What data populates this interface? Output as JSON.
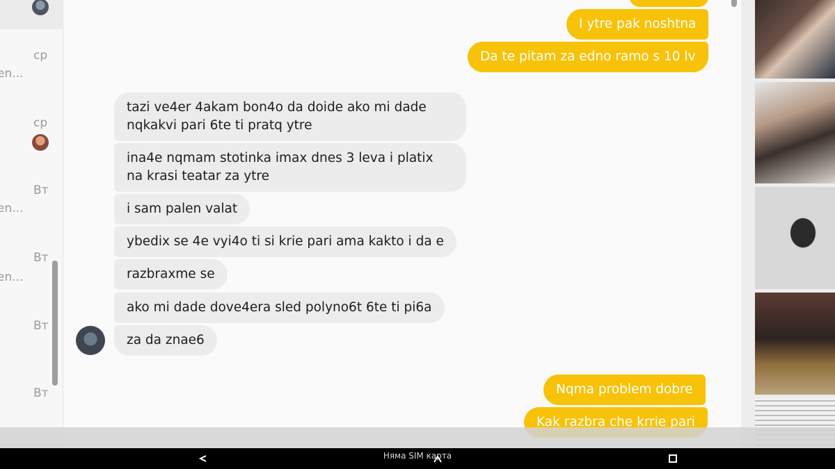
{
  "sidebar": {
    "days": [
      "ср",
      "ср",
      "Вт",
      "Вт",
      "Вт",
      "Вт"
    ],
    "snippets": [
      "en...",
      "en...",
      "en..."
    ]
  },
  "chat": {
    "messages": [
      {
        "side": "out",
        "text": "I ytre pak noshtna"
      },
      {
        "side": "out",
        "text": "Da te pitam za edno ramo s 10 lv"
      },
      {
        "side": "in",
        "text": "tazi ve4er 4akam bon4o da doide ako mi dade\nnqkakvi pari 6te ti pratq ytre"
      },
      {
        "side": "in",
        "text": "ina4e nqmam stotinka imax dnes 3 leva i platix\nna krasi teatar za ytre"
      },
      {
        "side": "in",
        "text": "i sam palen valat"
      },
      {
        "side": "in",
        "text": "ybedix se 4e vyi4o ti si krie pari ama kakto i da e"
      },
      {
        "side": "in",
        "text": "razbraxme se"
      },
      {
        "side": "in",
        "text": "ako mi dade dove4era sled polyno6t 6te ti pi6a"
      },
      {
        "side": "in",
        "text": "za da znae6"
      },
      {
        "side": "out",
        "text": "Nqma problem dobre"
      },
      {
        "side": "out",
        "text": "Kak razbra che krrie pari"
      }
    ]
  },
  "navbar": {
    "status": "Няма SIM карта"
  },
  "colors": {
    "outgoing_bubble": "#f7c208",
    "incoming_bubble": "#ececec"
  }
}
